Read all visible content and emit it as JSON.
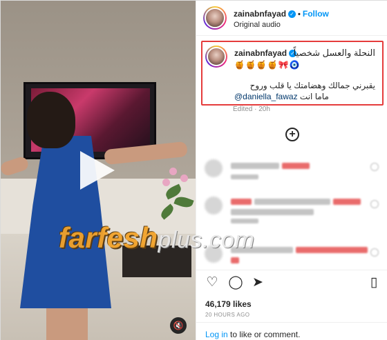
{
  "post": {
    "username": "zainabnfayad",
    "follow_label": "Follow",
    "audio_label": "Original audio"
  },
  "caption": {
    "username": "zainabnfayad",
    "line1": "النحلة والعسل شخصياً",
    "emojis": "🍯🍯🍯🍯🎀🧿",
    "line2": "يقبرني جمالك وهضامتك يا قلب وروح",
    "mention": "@daniella_fawaz",
    "line3_rest": "ماما انت",
    "edited": "Edited · 20h"
  },
  "stats": {
    "likes": "46,179 likes",
    "time_ago": "20 HOURS AGO"
  },
  "login_prompt": {
    "link": "Log in",
    "rest": " to like or comment."
  },
  "watermark": {
    "part1": "farfesh",
    "part2": "plus.com"
  },
  "icons": {
    "verified": "verified-badge-icon",
    "add": "add-comment-icon",
    "like": "heart-icon",
    "comment": "comment-icon",
    "share": "send-icon",
    "save": "bookmark-icon",
    "mute": "mute-icon",
    "play": "play-icon"
  },
  "colors": {
    "follow": "#0095f6",
    "highlight_border": "#e53b3b"
  }
}
